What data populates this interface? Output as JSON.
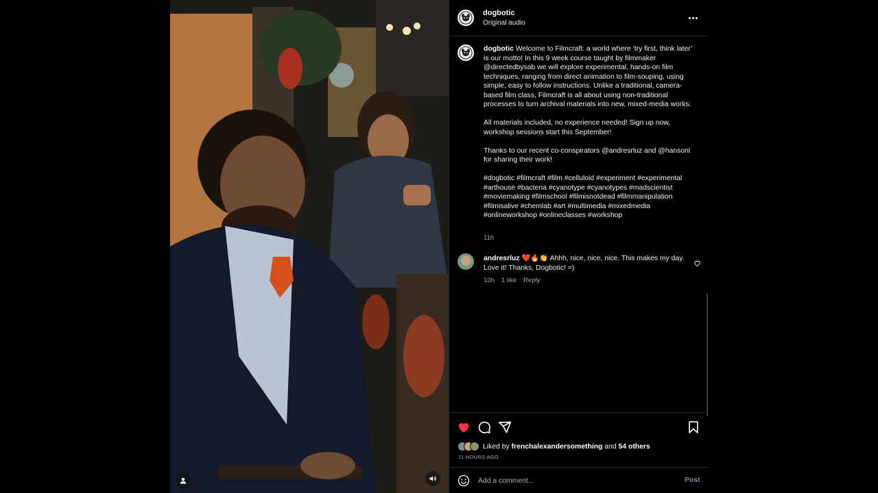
{
  "post": {
    "username": "dogbotic",
    "audio": "Original audio"
  },
  "caption": {
    "username": "dogbotic",
    "paragraph1": "Welcome to Filmcraft: a world where ‘try first, think later’ is our motto! In this 9 week course taught by filmmaker @directedbysab we will explore experimental, hands-on film techniques, ranging from direct animation to film-souping, using simple, easy to follow instructions. Unlike a traditional, camera-based film class, Filmcraft is all about using non-traditional processes to turn archival materials into new, mixed-media works.",
    "paragraph2": "All materials included, no experience needed! Sign up now, workshop sessions start this September!",
    "paragraph3": "Thanks to our recent co-conspirators @andresrluz and @hansonl for sharing their work!",
    "hashtags": "#dogbotic #filmcraft #film #celluloid #experiment #experimental #arthouse #bacteria #cyanotype #cyanotypes #madscientist #moviemaking #filmschool #filmisnotdead #filmmanipulation #filmisalive #chemlab #art #multimedia #mixedmedia #onlineworkshop #onlineclasses #workshop",
    "time": "11h"
  },
  "comments": [
    {
      "username": "andresrluz",
      "text": "❤️🔥👏 Ahhh, nice, nice, nice. This makes my day. Love it! Thanks, Dogbotic! =)",
      "time": "10h",
      "likes": "1 like",
      "reply_label": "Reply"
    }
  ],
  "likes": {
    "prefix": "Liked by",
    "user": "frenchalexandersomething",
    "joiner": "and",
    "others": "54 others"
  },
  "timestamp": "11 HOURS AGO",
  "composer": {
    "placeholder": "Add a comment...",
    "post_label": "Post"
  },
  "colors": {
    "like_active": "#ff3040",
    "background": "#000000",
    "post_disabled": "#7d8a9a"
  },
  "icons": {
    "header_more": "more-horizontal-icon",
    "like": "heart-filled-icon",
    "comment": "comment-bubble-icon",
    "share": "paper-plane-icon",
    "save": "bookmark-icon",
    "emoji": "smiley-icon",
    "mute": "speaker-icon",
    "tag": "person-icon"
  }
}
